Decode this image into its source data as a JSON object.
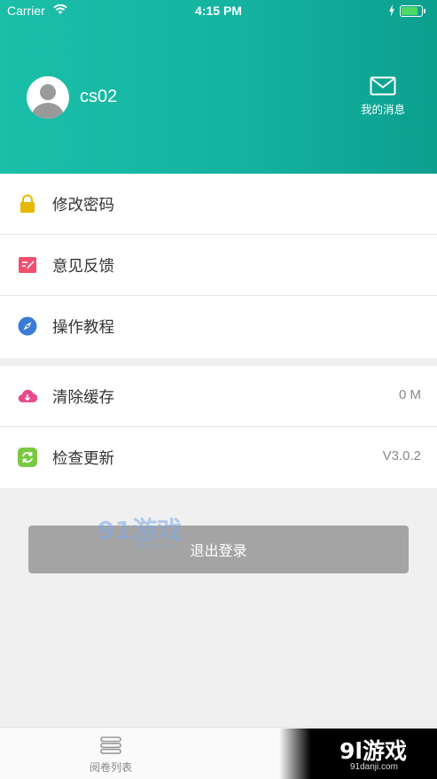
{
  "status_bar": {
    "carrier": "Carrier",
    "time": "4:15 PM",
    "battery_level": 0.85
  },
  "profile": {
    "username": "cs02",
    "messages_label": "我的消息"
  },
  "menu": [
    {
      "label": "修改密码",
      "icon": "lock-icon",
      "color": "#e6b800"
    },
    {
      "label": "意见反馈",
      "icon": "feedback-icon",
      "color": "#f0506e"
    },
    {
      "label": "操作教程",
      "icon": "compass-icon",
      "color": "#3a7bd5"
    }
  ],
  "settings": [
    {
      "label": "清除缓存",
      "value": "0 M",
      "icon": "cloud-download-icon",
      "color": "#e74c8c"
    },
    {
      "label": "检查更新",
      "value": "V3.0.2",
      "icon": "refresh-icon",
      "color": "#7ac943"
    }
  ],
  "logout_label": "退出登录",
  "tab_bar": {
    "tabs": [
      {
        "label": "阅卷列表",
        "icon": "list-icon"
      }
    ]
  },
  "watermark": {
    "small_logo": "91游戏",
    "small_url": "91danji.com",
    "text": "9l游戏",
    "url": "91danji.com"
  }
}
